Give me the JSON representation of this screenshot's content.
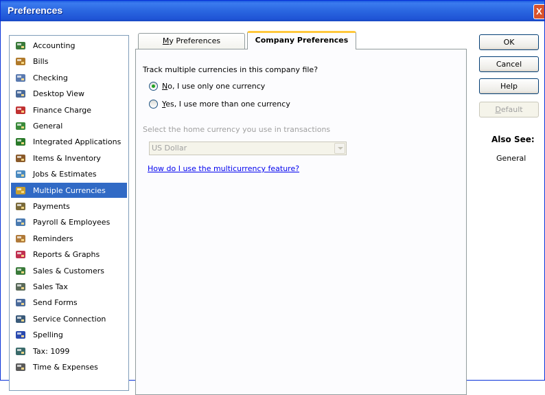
{
  "window": {
    "title": "Preferences",
    "close_glyph": "X"
  },
  "categories": [
    {
      "label": "Accounting",
      "icon": "accounting-icon",
      "color": "#3a7a3a"
    },
    {
      "label": "Bills",
      "icon": "bills-icon",
      "color": "#b07a2a"
    },
    {
      "label": "Checking",
      "icon": "checking-icon",
      "color": "#5a7ab0"
    },
    {
      "label": "Desktop View",
      "icon": "desktop-view-icon",
      "color": "#4a6a9a"
    },
    {
      "label": "Finance Charge",
      "icon": "finance-charge-icon",
      "color": "#c03030"
    },
    {
      "label": "General",
      "icon": "general-icon",
      "color": "#3a8a3a"
    },
    {
      "label": "Integrated Applications",
      "icon": "integrated-applications-icon",
      "color": "#2a7a2a"
    },
    {
      "label": "Items & Inventory",
      "icon": "items-inventory-icon",
      "color": "#8a5a2a"
    },
    {
      "label": "Jobs & Estimates",
      "icon": "jobs-estimates-icon",
      "color": "#4a8ac0"
    },
    {
      "label": "Multiple Currencies",
      "icon": "multiple-currencies-icon",
      "color": "#c8a030"
    },
    {
      "label": "Payments",
      "icon": "payments-icon",
      "color": "#7a6a3a"
    },
    {
      "label": "Payroll & Employees",
      "icon": "payroll-employees-icon",
      "color": "#4a7ab0"
    },
    {
      "label": "Reminders",
      "icon": "reminders-icon",
      "color": "#b07a3a"
    },
    {
      "label": "Reports & Graphs",
      "icon": "reports-graphs-icon",
      "color": "#c03050"
    },
    {
      "label": "Sales & Customers",
      "icon": "sales-customers-icon",
      "color": "#3a7a3a"
    },
    {
      "label": "Sales Tax",
      "icon": "sales-tax-icon",
      "color": "#5a6a5a"
    },
    {
      "label": "Send Forms",
      "icon": "send-forms-icon",
      "color": "#4a6a9a"
    },
    {
      "label": "Service Connection",
      "icon": "service-connection-icon",
      "color": "#3a5a7a"
    },
    {
      "label": "Spelling",
      "icon": "spelling-icon",
      "color": "#2a4ab0"
    },
    {
      "label": "Tax: 1099",
      "icon": "tax-1099-icon",
      "color": "#3a6a6a"
    },
    {
      "label": "Time & Expenses",
      "icon": "time-expenses-icon",
      "color": "#5a5a5a"
    }
  ],
  "selected_category": "Multiple Currencies",
  "tabs": {
    "my_prefs": {
      "accel": "M",
      "rest": "y Preferences"
    },
    "company_prefs": {
      "label": "Company Preferences"
    }
  },
  "content": {
    "question": "Track multiple currencies in this company file?",
    "option_no": {
      "accel": "N",
      "rest": "o, I use only one currency",
      "checked": true
    },
    "option_yes": {
      "accel": "Y",
      "rest": "es, I use more than one currency",
      "checked": false
    },
    "home_currency_label": "Select the home currency you use in transactions",
    "home_currency_value": "US Dollar",
    "help_link": "How do I use the multicurrency feature?"
  },
  "buttons": {
    "ok": "OK",
    "cancel": "Cancel",
    "help": "Help",
    "default_accel": "D",
    "default_rest": "efault"
  },
  "also_see": {
    "heading": "Also See:",
    "link": "General"
  },
  "colors": {
    "selection": "#316ac5",
    "tab_accent": "#ffc83c",
    "link": "#0000ee"
  }
}
